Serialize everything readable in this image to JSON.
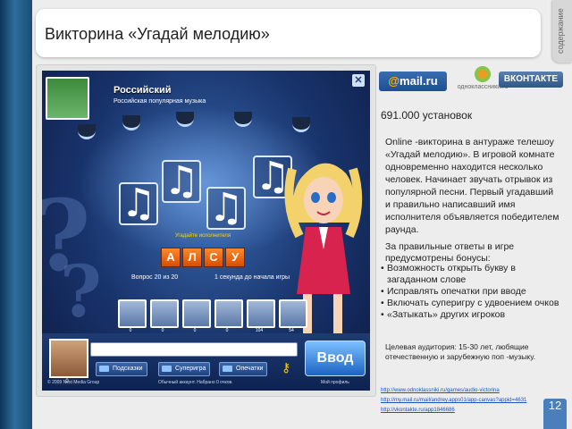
{
  "slide": {
    "title": "Викторина «Угадай мелодию»",
    "side_tab": "содержание",
    "page_number": "12"
  },
  "game": {
    "genre_title": "Российский",
    "genre_subtitle": "Российская популярная музыка",
    "close_glyph": "✕",
    "hint_label": "Угадайте исполнителя",
    "letters": [
      "А",
      "Л",
      "С",
      "У"
    ],
    "question_counter": "Вопрос 20 из 20",
    "timer_text": "1 секунда до начала игры",
    "players": [
      {
        "score": "0"
      },
      {
        "score": "0"
      },
      {
        "score": "0"
      },
      {
        "score": "0"
      },
      {
        "score": "104"
      },
      {
        "score": "54"
      }
    ],
    "own_score": "0",
    "hints_button": "Подсказки",
    "supergame_button": "Суперигра",
    "typos_button": "Опечатки",
    "enter_button": "Ввод",
    "copyright": "© 2009 Next Media Group",
    "account_status": "Обычный аккаунт. Набрано 0 очков.",
    "profile_link": "Мой профиль"
  },
  "logos": {
    "mailru_at": "@",
    "mailru_text": "mail.ru",
    "ok_text": "одноклассники.ru",
    "vk_text": "ВКОНТАКТЕ"
  },
  "info": {
    "installs": "691.000 установок",
    "description": "Online -викторина в антураже телешоу «Угадай мелодию». В игровой комнате одновременно находится несколько человек. Начинает звучать отрывок из популярной песни. Первый угадавший и правильно написавший имя исполнителя объявляется победителем раунда.",
    "bonus_intro": "За правильные ответы в игре предусмотрены бонусы:",
    "bonuses": [
      "Возможность открыть букву в загаданном слове",
      "Исправлять опечатки при вводе",
      "Включать суперигру с удвоением очков",
      "«Затыкать» других игроков"
    ],
    "audience": "Целевая аудитория: 15-30 лет, любящие отечественную и зарубежную поп -музыку."
  },
  "links": [
    "http://www.odnoklassniki.ru/games/audio-victorina",
    "http://my.mail.ru/mail/andrey.apps01/app-canvas?appid=4631",
    "http://vkontakte.ru/app1846686"
  ]
}
